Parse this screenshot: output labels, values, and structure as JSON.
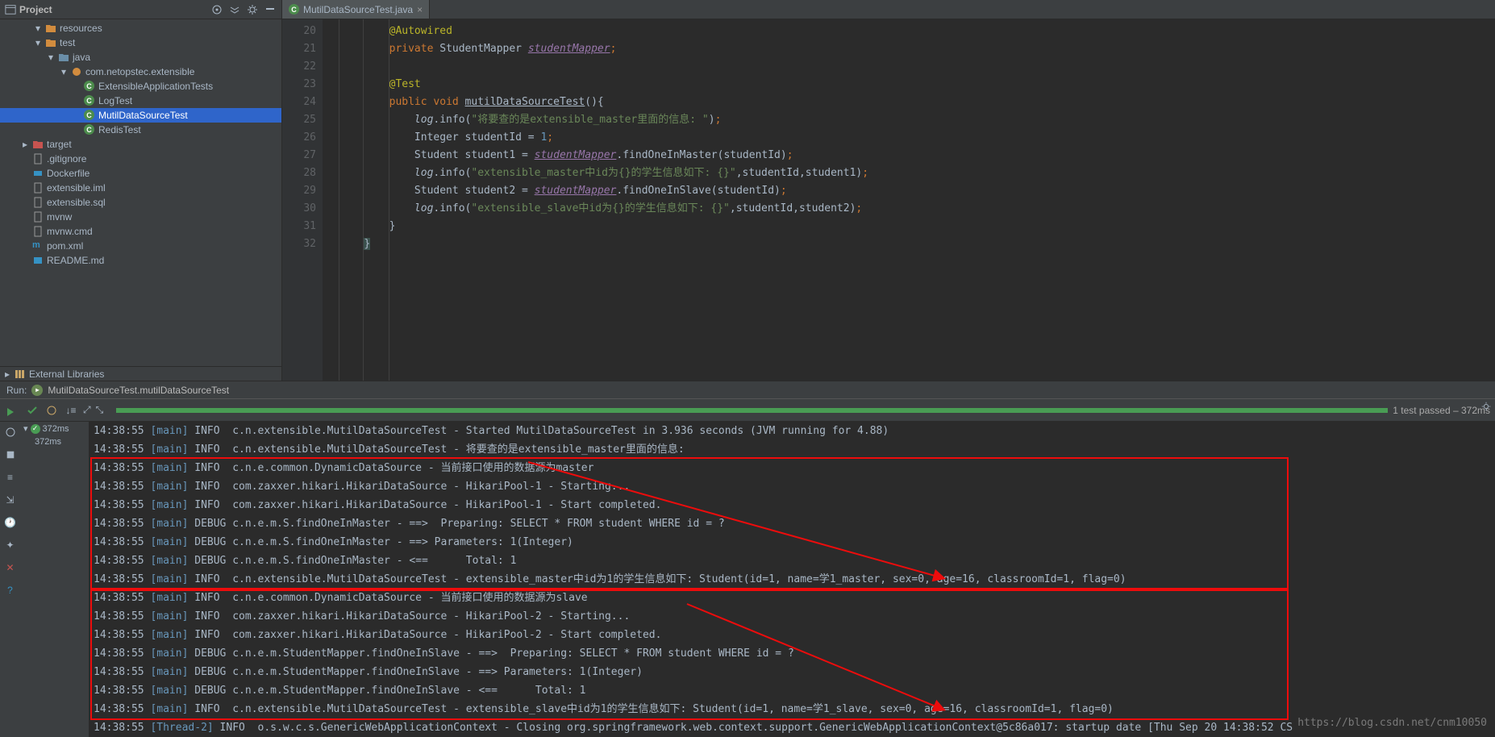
{
  "panel": {
    "title": "Project",
    "ext_lib": "External Libraries"
  },
  "tree": [
    {
      "depth": 1,
      "arrow": "▾",
      "iconType": "folder",
      "label": "resources",
      "name": "tree-resources"
    },
    {
      "depth": 1,
      "arrow": "▾",
      "iconType": "folder",
      "label": "test",
      "name": "tree-test"
    },
    {
      "depth": 2,
      "arrow": "▾",
      "iconType": "folder",
      "label": "java",
      "name": "tree-java",
      "folderColor": "#6a8ea8"
    },
    {
      "depth": 3,
      "arrow": "▾",
      "iconType": "pkg",
      "label": "com.netopstec.extensible",
      "name": "tree-package"
    },
    {
      "depth": 4,
      "iconType": "class",
      "label": "ExtensibleApplicationTests",
      "name": "tree-ext-tests"
    },
    {
      "depth": 4,
      "iconType": "class",
      "label": "LogTest",
      "name": "tree-logtest"
    },
    {
      "depth": 4,
      "iconType": "class",
      "label": "MutilDataSourceTest",
      "name": "tree-mutil",
      "selected": true
    },
    {
      "depth": 4,
      "iconType": "class",
      "label": "RedisTest",
      "name": "tree-redistest"
    },
    {
      "depth": 0,
      "arrow": "▸",
      "iconType": "folder",
      "label": "target",
      "name": "tree-target",
      "folderColor": "#c75450"
    },
    {
      "depth": 0,
      "iconType": "file",
      "label": ".gitignore",
      "name": "tree-gitignore"
    },
    {
      "depth": 0,
      "iconType": "docker",
      "label": "Dockerfile",
      "name": "tree-dockerfile"
    },
    {
      "depth": 0,
      "iconType": "file",
      "label": "extensible.iml",
      "name": "tree-iml"
    },
    {
      "depth": 0,
      "iconType": "file",
      "label": "extensible.sql",
      "name": "tree-sql"
    },
    {
      "depth": 0,
      "iconType": "file",
      "label": "mvnw",
      "name": "tree-mvnw"
    },
    {
      "depth": 0,
      "iconType": "file",
      "label": "mvnw.cmd",
      "name": "tree-mvnwcmd"
    },
    {
      "depth": 0,
      "iconType": "maven",
      "label": "pom.xml",
      "name": "tree-pom"
    },
    {
      "depth": 0,
      "iconType": "md",
      "label": "README.md",
      "name": "tree-readme"
    }
  ],
  "tab": {
    "label": "MutilDataSourceTest.java",
    "close": "×"
  },
  "code_lines": [
    20,
    21,
    22,
    23,
    24,
    25,
    26,
    27,
    28,
    29,
    30,
    31,
    32
  ],
  "code_html": [
    "        <span class='anno'>@Autowired</span>",
    "        <span class='kw'>private</span> StudentMapper <span class='field'>studentMapper</span><span class='semi'>;</span>",
    "",
    "        <span class='anno'>@Test</span>",
    "        <span class='kw'>public void</span> <span class='method-u'>mutilDataSourceTest</span>(){",
    "            <span class='ital'>log</span>.info(<span class='str'>\"将要查的是extensible_master里面的信息: \"</span>)<span class='semi'>;</span>",
    "            Integer studentId = <span class='num'>1</span><span class='semi'>;</span>",
    "            Student student1 = <span class='field'>studentMapper</span>.findOneInMaster(studentId)<span class='semi'>;</span>",
    "            <span class='ital'>log</span>.info(<span class='str'>\"extensible_master中id为{}的学生信息如下: {}\"</span>,studentId,student1)<span class='semi'>;</span>",
    "            Student student2 = <span class='field'>studentMapper</span>.findOneInSlave(studentId)<span class='semi'>;</span>",
    "            <span class='ital'>log</span>.info(<span class='str'>\"extensible_slave中id为{}的学生信息如下: {}\"</span>,studentId,student2)<span class='semi'>;</span>",
    "        }",
    "    <span style='background:#3b514d;'>}</span>"
  ],
  "run": {
    "label": "Run:",
    "test_name": "MutilDataSourceTest.mutilDataSourceTest"
  },
  "test": {
    "pass_text": "1 test passed – 372ms",
    "time1": "372ms",
    "time2": "372ms"
  },
  "logs": [
    "14:38:55 [main] INFO  c.n.extensible.MutilDataSourceTest - Started MutilDataSourceTest in 3.936 seconds (JVM running for 4.88)",
    "14:38:55 [main] INFO  c.n.extensible.MutilDataSourceTest - 将要查的是extensible_master里面的信息:",
    "14:38:55 [main] INFO  c.n.e.common.DynamicDataSource - 当前接口使用的数据源为master",
    "14:38:55 [main] INFO  com.zaxxer.hikari.HikariDataSource - HikariPool-1 - Starting...",
    "14:38:55 [main] INFO  com.zaxxer.hikari.HikariDataSource - HikariPool-1 - Start completed.",
    "14:38:55 [main] DEBUG c.n.e.m.S.findOneInMaster - ==>  Preparing: SELECT * FROM student WHERE id = ?",
    "14:38:55 [main] DEBUG c.n.e.m.S.findOneInMaster - ==> Parameters: 1(Integer)",
    "14:38:55 [main] DEBUG c.n.e.m.S.findOneInMaster - <==      Total: 1",
    "14:38:55 [main] INFO  c.n.extensible.MutilDataSourceTest - extensible_master中id为1的学生信息如下: Student(id=1, name=学1_master, sex=0, age=16, classroomId=1, flag=0)",
    "14:38:55 [main] INFO  c.n.e.common.DynamicDataSource - 当前接口使用的数据源为slave",
    "14:38:55 [main] INFO  com.zaxxer.hikari.HikariDataSource - HikariPool-2 - Starting...",
    "14:38:55 [main] INFO  com.zaxxer.hikari.HikariDataSource - HikariPool-2 - Start completed.",
    "14:38:55 [main] DEBUG c.n.e.m.StudentMapper.findOneInSlave - ==>  Preparing: SELECT * FROM student WHERE id = ?",
    "14:38:55 [main] DEBUG c.n.e.m.StudentMapper.findOneInSlave - ==> Parameters: 1(Integer)",
    "14:38:55 [main] DEBUG c.n.e.m.StudentMapper.findOneInSlave - <==      Total: 1",
    "14:38:55 [main] INFO  c.n.extensible.MutilDataSourceTest - extensible_slave中id为1的学生信息如下: Student(id=1, name=学1_slave, sex=0, age=16, classroomId=1, flag=0)",
    "14:38:55 [Thread-2] INFO  o.s.w.c.s.GenericWebApplicationContext - Closing org.springframework.web.context.support.GenericWebApplicationContext@5c86a017: startup date [Thu Sep 20 14:38:52 CS"
  ],
  "watermark": "https://blog.csdn.net/cnm10050"
}
